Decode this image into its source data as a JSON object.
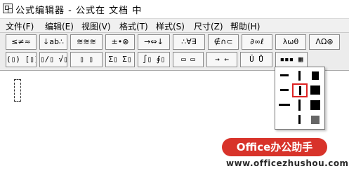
{
  "window": {
    "title": "公式编辑器 - 公式在 文档 中"
  },
  "menubar": {
    "items": [
      "文件(F)",
      "编辑(E)",
      "视图(V)",
      "格式(T)",
      "样式(S)",
      "尺寸(Z)",
      "帮助(H)"
    ]
  },
  "toolbar": {
    "row1": [
      "≤≠≈",
      "↓ab∴",
      "≋≋≋",
      "±•⊗",
      "→⇔↓",
      "∴∀∃",
      "∉∩⊂",
      "∂∞ℓ",
      "λωθ",
      "ΛΩ⊛"
    ],
    "row2": [
      "(▯) [▯]",
      "▯/▯ √▯",
      "▯ ▯",
      "Σ▯ Σ▯",
      "∫▯ ∮▯",
      "▭ ▭",
      "→ ←",
      "Ū Ů",
      "▪▪▪ ▦"
    ]
  },
  "palette": {
    "selected_index": 4
  },
  "watermark": {
    "badge": "Office办公助手",
    "url": "www.officezhushou.com"
  },
  "colors": {
    "selection_border": "#dd2222",
    "watermark_red": "#d8332a"
  }
}
